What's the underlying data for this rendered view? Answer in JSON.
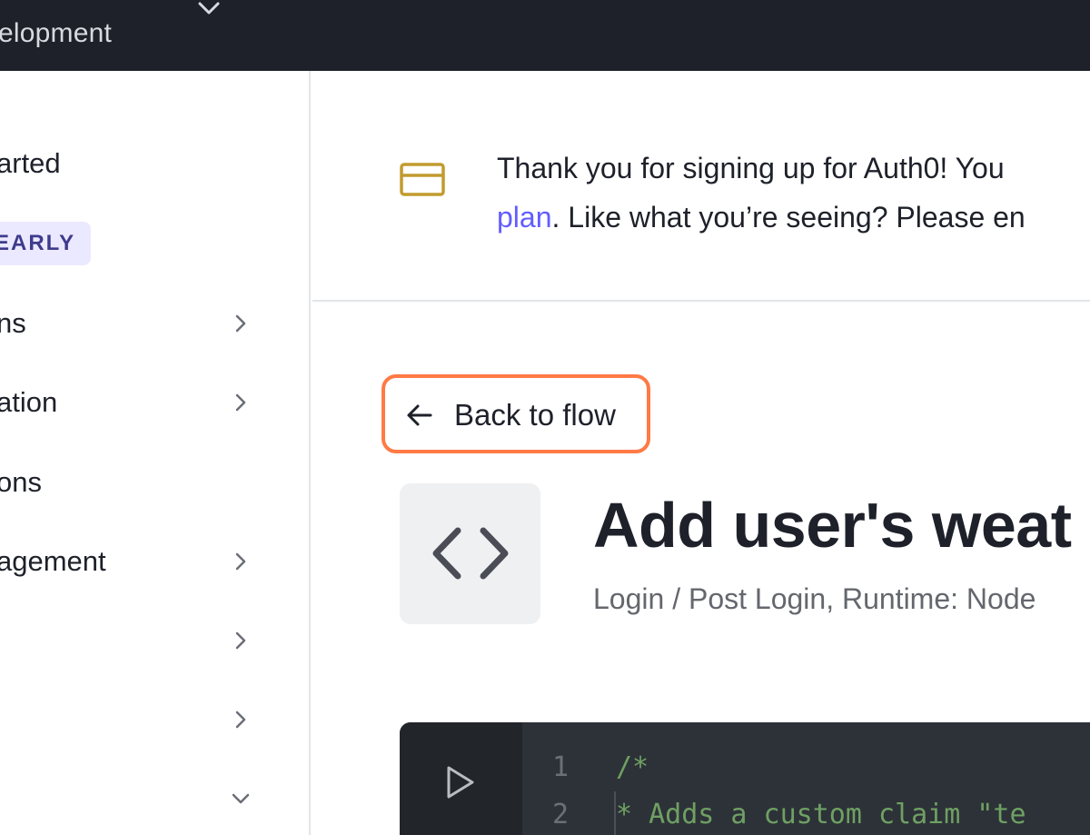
{
  "topbar": {
    "tenant_name": "elopment",
    "tenant_chevron_icon": "chevron-down-icon"
  },
  "sidebar": {
    "items": [
      {
        "label": "arted",
        "chevron": "none"
      },
      {
        "label": "ns",
        "chevron": "chevron-right-icon"
      },
      {
        "label": "ation",
        "chevron": "chevron-right-icon"
      },
      {
        "label": "ons",
        "chevron": "none"
      },
      {
        "label": "agement",
        "chevron": "chevron-right-icon"
      },
      {
        "label": "",
        "chevron": "chevron-right-icon"
      },
      {
        "label": "",
        "chevron": "chevron-right-icon"
      },
      {
        "label": "",
        "chevron": "chevron-down-icon"
      }
    ],
    "badge": "EARLY"
  },
  "banner": {
    "icon": "credit-card-icon",
    "line1": "Thank you for signing up for Auth0! You",
    "plan_link": "plan",
    "line2_rest": ". Like what you’re seeing? Please en"
  },
  "back": {
    "label": "Back to flow",
    "icon": "arrow-left-icon"
  },
  "action": {
    "icon": "code-icon",
    "title": "Add user's weat",
    "subtitle": "Login / Post Login, Runtime: Node"
  },
  "editor": {
    "run_icon": "play-icon",
    "lines": [
      {
        "num": "1",
        "text": "/*"
      },
      {
        "num": "2",
        "text": " * Adds a custom claim \"te"
      }
    ]
  },
  "colors": {
    "topbar_bg": "#1e212a",
    "link": "#635dff",
    "highlight_border": "#ff7a45",
    "card_icon": "#c19b2e",
    "code_comment": "#6fa063"
  }
}
